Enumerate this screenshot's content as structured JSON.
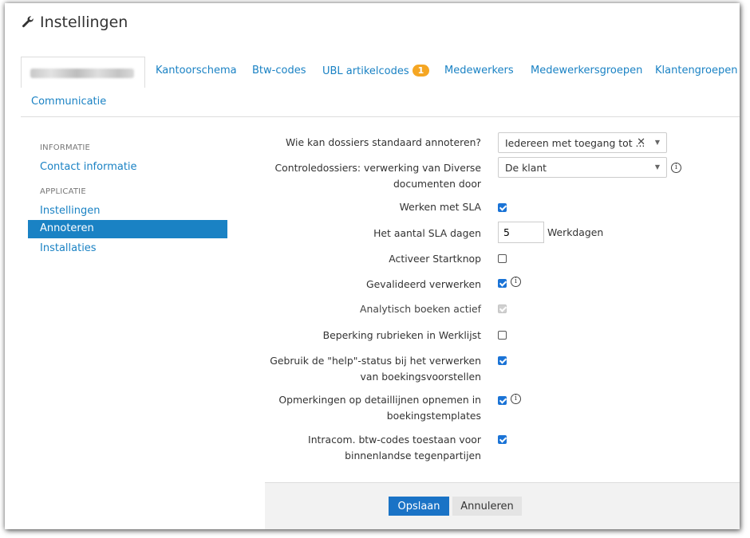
{
  "page": {
    "title": "Instellingen",
    "icon": "wrench-icon"
  },
  "tabs": [
    {
      "label": "",
      "active": true,
      "note": "blurred"
    },
    {
      "label": "Kantoorschema"
    },
    {
      "label": "Btw-codes"
    },
    {
      "label": "UBL artikelcodes",
      "badge": "1"
    },
    {
      "label": "Medewerkers"
    },
    {
      "label": "Medewerkersgroepen"
    },
    {
      "label": "Klantengroepen"
    },
    {
      "label": "Communicatie"
    }
  ],
  "sidebar": {
    "sections": [
      {
        "heading": "INFORMATIE",
        "items": [
          {
            "label": "Contact informatie"
          }
        ]
      },
      {
        "heading": "APPLICATIE",
        "items": [
          {
            "label": "Instellingen"
          },
          {
            "label": "Annoteren",
            "active": true
          },
          {
            "label": "Installaties"
          }
        ]
      }
    ]
  },
  "form": {
    "annotate_default": {
      "label": "Wie kan dossiers standaard annoteren?",
      "value": "Iedereen met toegang tot ...",
      "clear": "✕",
      "caret": "▼"
    },
    "control_dossiers": {
      "label_line1": "Controledossiers: verwerking van Diverse",
      "label_line2": "documenten door",
      "value": "De klant",
      "caret": "▼",
      "info": "i"
    },
    "sla": {
      "label": "Werken met SLA",
      "checked": true
    },
    "sla_days": {
      "label": "Het aantal SLA dagen",
      "value": "5",
      "suffix": "Werkdagen"
    },
    "startknop": {
      "label": "Activeer Startknop",
      "checked": false
    },
    "gevalideerd": {
      "label": "Gevalideerd verwerken",
      "checked": true,
      "info": "i"
    },
    "analytisch": {
      "label": "Analytisch boeken actief",
      "checked": true,
      "disabled": true
    },
    "beperking": {
      "label": "Beperking rubrieken in Werklijst",
      "checked": false
    },
    "help_status": {
      "label_line1": "Gebruik de \"help\"-status bij het verwerken",
      "label_line2": "van boekingsvoorstellen",
      "checked": true
    },
    "opmerkingen": {
      "label_line1": "Opmerkingen op detaillijnen opnemen in",
      "label_line2": "boekingstemplates",
      "checked": true,
      "info": "i"
    },
    "intracom": {
      "label_line1": "Intracom. btw-codes toestaan voor",
      "label_line2": "binnenlandse tegenpartijen",
      "checked": true
    }
  },
  "footer": {
    "save_label": "Opslaan",
    "cancel_label": "Annuleren"
  },
  "colors": {
    "accent": "#1a82c4",
    "badge": "#f5a623",
    "checkbox": "#1a73d6"
  }
}
